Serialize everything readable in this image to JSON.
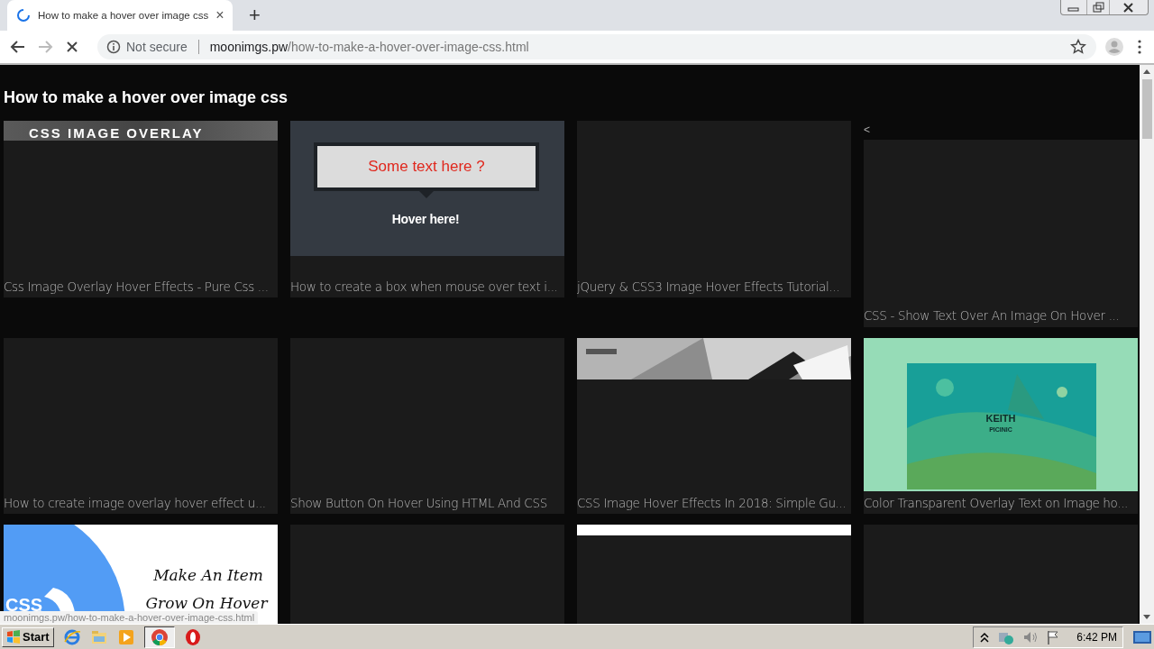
{
  "browser": {
    "tab": {
      "title": "How to make a hover over image css",
      "loading": true,
      "close": "×"
    },
    "new_tab": "+",
    "loading": true,
    "address": {
      "security": "Not secure",
      "host": "moonimgs.pw",
      "path": "/how-to-make-a-hover-over-image-css.html"
    }
  },
  "page": {
    "heading": "How to make a hover over image css",
    "cards": [
      {
        "caption": "Css Image Overlay Hover Effects - Pure Css ...",
        "thumbnail": {
          "kind": "banner-strip",
          "texts": [
            "CSS IMAGE OVERLAY"
          ]
        }
      },
      {
        "caption": "How to create a box when mouse over text i...",
        "thumbnail": {
          "kind": "tooltip-demo",
          "texts": [
            "Some text here ?",
            "Hover here!"
          ]
        }
      },
      {
        "caption": "jQuery & CSS3 Image Hover Effects Tutorial...",
        "thumbnail": {
          "kind": "blank"
        }
      },
      {
        "prefix": "<",
        "caption": "CSS - Show Text Over An Image On Hover ...",
        "thumbnail": {
          "kind": "blank"
        }
      },
      {
        "caption": "How to create image overlay hover effect u...",
        "thumbnail": {
          "kind": "blank"
        }
      },
      {
        "caption": "Show Button On Hover Using HTML And CSS",
        "thumbnail": {
          "kind": "blank"
        }
      },
      {
        "caption": "CSS Image Hover Effects In 2018: Simple Gu...",
        "thumbnail": {
          "kind": "photo-strip"
        }
      },
      {
        "caption": "Color Transparent Overlay Text on Image ho...",
        "thumbnail": {
          "kind": "photo-overlay",
          "texts": [
            "KEITH",
            "PICINIC"
          ]
        }
      },
      {
        "thumbnail": {
          "kind": "css-logo",
          "texts": [
            "CSS",
            "Make An Item",
            "Grow On Hover"
          ]
        }
      },
      {
        "thumbnail": {
          "kind": "blank"
        }
      },
      {
        "thumbnail": {
          "kind": "white-strip"
        }
      },
      {
        "thumbnail": {
          "kind": "blank"
        }
      }
    ]
  },
  "status_url": "moonimgs.pw/how-to-make-a-hover-over-image-css.html",
  "taskbar": {
    "start": "Start",
    "clock": "6:42 PM"
  }
}
